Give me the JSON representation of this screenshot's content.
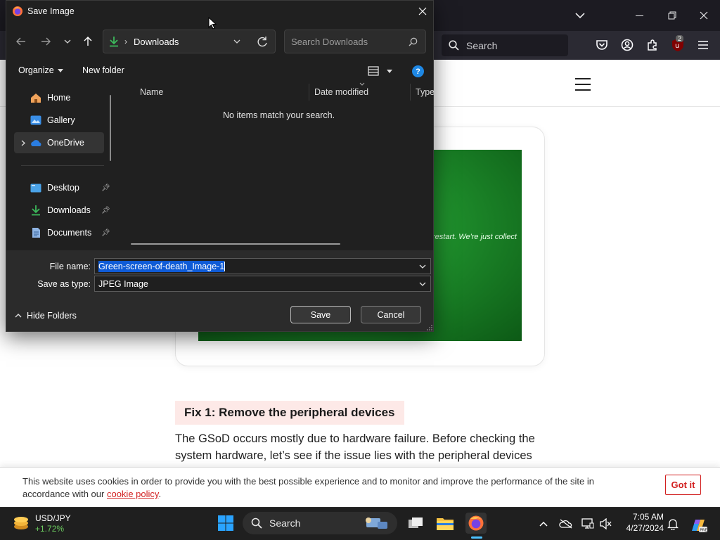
{
  "dialog": {
    "title": "Save Image",
    "address_folder": "Downloads",
    "search_placeholder": "Search Downloads",
    "organize_label": "Organize",
    "new_folder_label": "New folder",
    "nav_items": [
      {
        "label": "Home",
        "icon": "home-icon"
      },
      {
        "label": "Gallery",
        "icon": "gallery-icon"
      },
      {
        "label": "OneDrive",
        "icon": "onedrive-icon"
      },
      {
        "label": "Desktop",
        "icon": "desktop-icon"
      },
      {
        "label": "Downloads",
        "icon": "downloads-icon"
      },
      {
        "label": "Documents",
        "icon": "documents-icon"
      }
    ],
    "columns": [
      "Name",
      "Date modified",
      "Type"
    ],
    "empty_message": "No items match your search.",
    "file_name_label": "File name:",
    "file_name_value": "Green-screen-of-death_Image-1",
    "save_as_type_label": "Save as type:",
    "save_as_type_value": "JPEG Image",
    "hide_folders_label": "Hide Folders",
    "save_button": "Save",
    "cancel_button": "Cancel"
  },
  "browser": {
    "search_label": "Search",
    "extension_badge": "2"
  },
  "page": {
    "image_caption_text": "restart. We're just collect",
    "fix_heading": "Fix 1: Remove the peripheral devices",
    "article_line1": "The GSoD occurs mostly due to hardware failure. Before checking the",
    "article_line2": "system hardware, let’s see if the issue lies with the peripheral devices",
    "cookie_text_pre": "This website uses cookies in order to provide you with the best possible experience and to monitor and improve the performance of the site in accordance with our",
    "cookie_link": "cookie policy",
    "cookie_text_post": ".",
    "got_it": "Got it"
  },
  "taskbar": {
    "ticker_name": "USD/JPY",
    "ticker_change": "+1.72%",
    "search_label": "Search",
    "time": "7:05 AM",
    "date": "4/27/2024"
  },
  "colors": {
    "accent_blue": "#0f5bd6",
    "cookie_red": "#d21f1f",
    "gsod_green": "#1d8a2a",
    "ticker_green": "#6ccb5f"
  }
}
